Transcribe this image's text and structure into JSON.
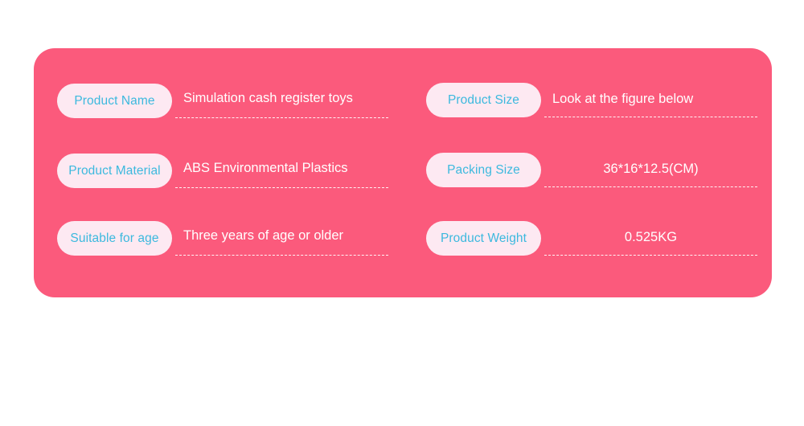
{
  "colors": {
    "page_background": "#ffffff",
    "card_background": "#fb5a7c",
    "pill_background": "#fde9f2",
    "label_text": "#3cb9de",
    "value_text": "#ffffff",
    "rule": "#ffffff"
  },
  "spec_card": {
    "columns": [
      {
        "id": "left",
        "rows": [
          {
            "label": "Product Name",
            "value": "Simulation cash register toys",
            "align": "left"
          },
          {
            "label": "Product Material",
            "value": "ABS Environmental Plastics",
            "align": "left"
          },
          {
            "label": "Suitable for age",
            "value": "Three years of age or older",
            "align": "left"
          }
        ]
      },
      {
        "id": "right",
        "rows": [
          {
            "label": "Product Size",
            "value": "Look at the figure below",
            "align": "left"
          },
          {
            "label": "Packing Size",
            "value": "36*16*12.5(CM)",
            "align": "center"
          },
          {
            "label": "Product Weight",
            "value": "0.525KG",
            "align": "center"
          }
        ]
      }
    ]
  }
}
